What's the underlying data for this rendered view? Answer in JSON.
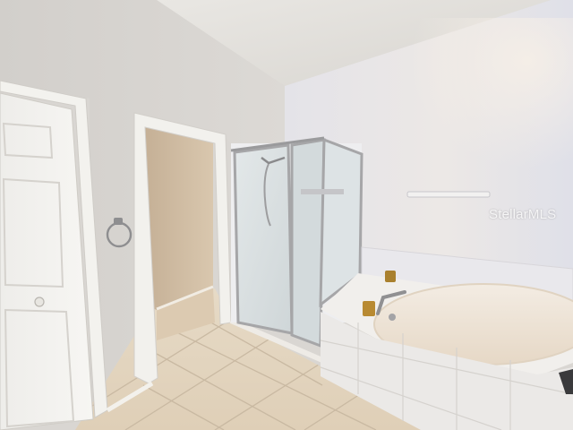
{
  "photo": {
    "watermark_text": "StellarMLS"
  },
  "palette": {
    "ceiling": "#e3e0dc",
    "wall_left": "#d8d5d1",
    "wall_right": "#e6e5e9",
    "trim": "#f4f3ef",
    "floor_tile": "#e4d6c1",
    "grout": "#cbbba4",
    "closet_interior": "#cdb9a0",
    "shower_glass": "#d9e0e2",
    "tub": "#efe6da",
    "tub_tile": "#eceae8",
    "chrome": "#9a9a9c"
  }
}
